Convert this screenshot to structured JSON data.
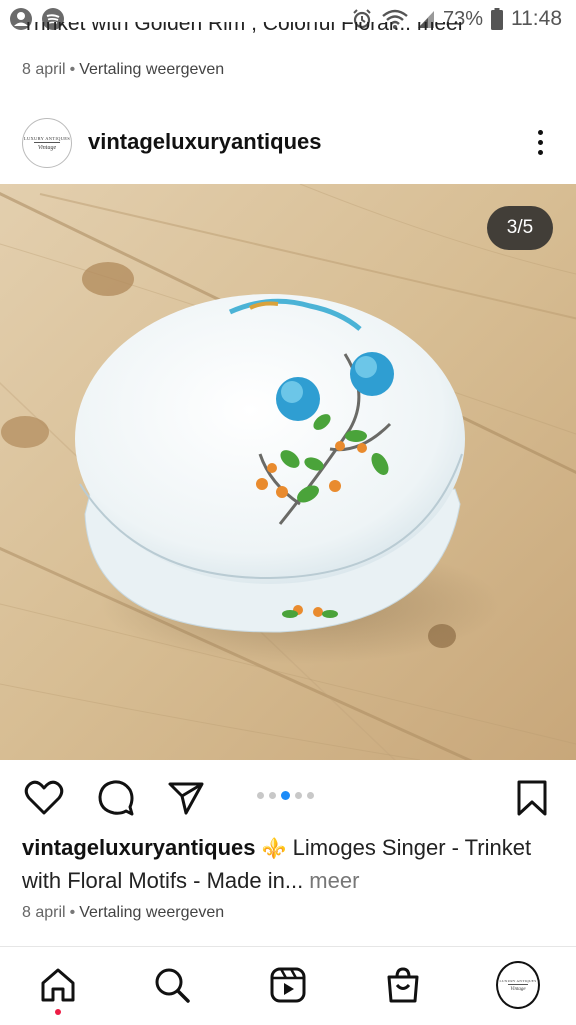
{
  "status_bar": {
    "battery": "73%",
    "time": "11:48",
    "icons": [
      "account-icon",
      "spotify-icon",
      "alarm-icon",
      "wifi-icon",
      "signal-icon",
      "battery-icon"
    ]
  },
  "previous_post": {
    "caption_cut": "Trinket with Golden Rim , Colorful Floral... meer",
    "date": "8 april",
    "translate": "Vertaling weergeven"
  },
  "post": {
    "username": "vintageluxuryantiques",
    "avatar": {
      "line1": "LUXURY ANTIQUES",
      "line2": "Vintage"
    },
    "counter": "3/5",
    "carousel": {
      "total": 5,
      "active_index": 2
    },
    "caption": {
      "username": "vintageluxuryantiques",
      "emoji": "⚜️",
      "text": " Limoges Singer - Trinket with Floral Motifs - Made in...",
      "more": " meer"
    },
    "date": "8 april",
    "translate": "Vertaling weergeven"
  },
  "bottom_nav": [
    "home-icon",
    "search-icon",
    "reels-icon",
    "shop-icon",
    "profile-avatar"
  ],
  "colors": {
    "accent_blue": "#1d8cf8",
    "notification_red": "#ed1c45"
  }
}
